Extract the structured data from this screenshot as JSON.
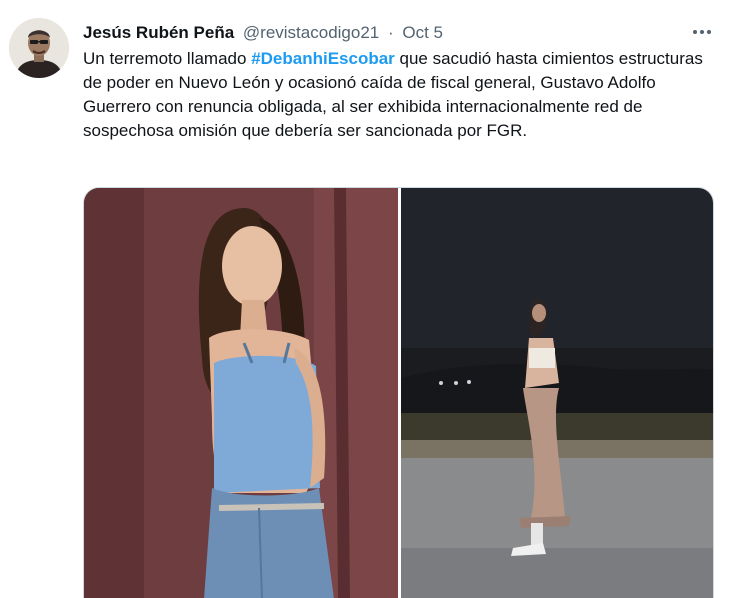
{
  "tweet": {
    "author_name": "Jesús Rubén Peña",
    "handle": "@revistacodigo21",
    "separator": "·",
    "date": "Oct 5",
    "text_before": "Un terremoto llamado ",
    "hashtag": "#DebanhiEscobar",
    "text_after": " que sacudió hasta cimientos estructuras de poder en Nuevo León y ocasionó caída de fiscal general, Gustavo Adolfo Guerrero con renuncia obligada, al ser exhibida internacionalmente red de sospechosa omisión que debería ser sancionada por FGR."
  },
  "icons": {
    "more": "more-options-icon"
  },
  "colors": {
    "link": "#1d9bf0",
    "secondary_text": "#536471",
    "primary_text": "#0f1419"
  }
}
